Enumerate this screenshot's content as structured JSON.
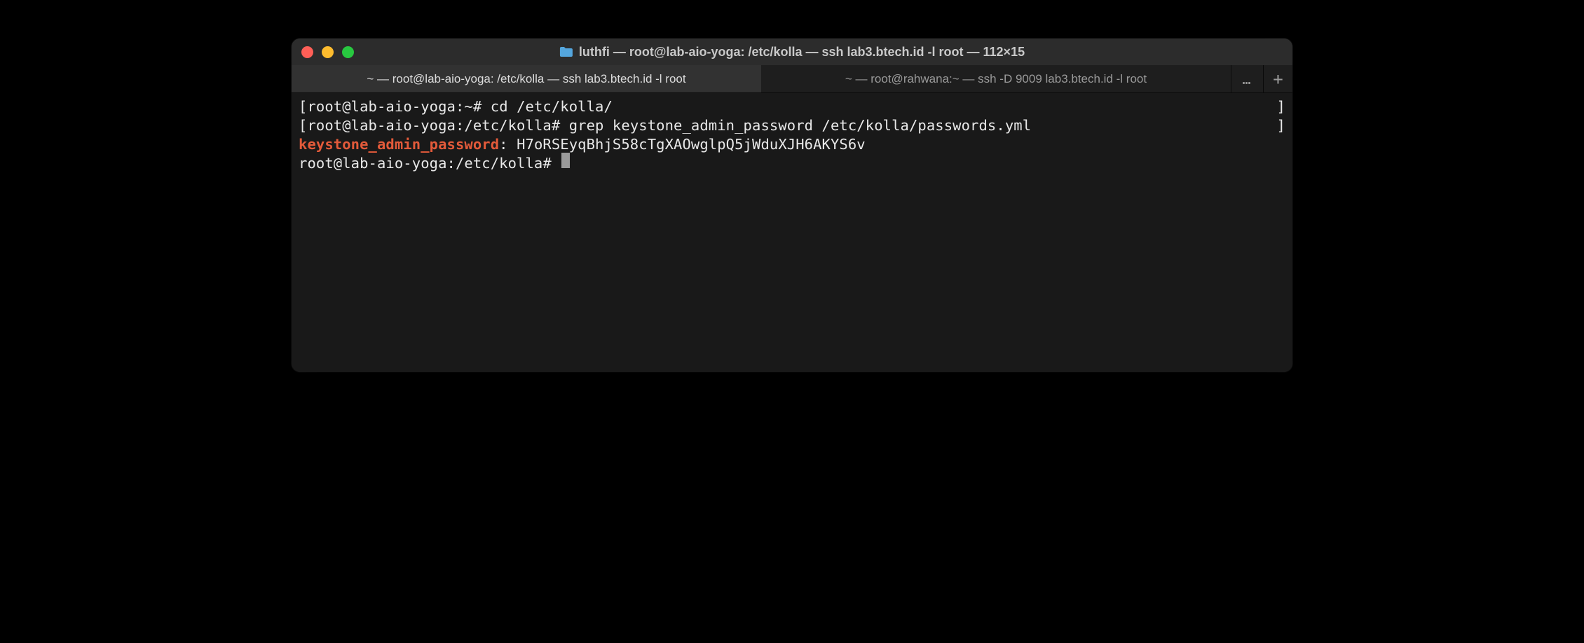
{
  "window": {
    "title": "luthfi — root@lab-aio-yoga: /etc/kolla — ssh lab3.btech.id -l root — 112×15"
  },
  "tabs": [
    {
      "label": "~ — root@lab-aio-yoga: /etc/kolla — ssh lab3.btech.id -l root",
      "active": true
    },
    {
      "label": "~ — root@rahwana:~ — ssh -D 9009 lab3.btech.id -l root",
      "active": false
    }
  ],
  "terminal": {
    "lines": [
      {
        "bracket_left": "[",
        "prompt": "root@lab-aio-yoga:~# ",
        "command": "cd /etc/kolla/",
        "bracket_right": "]"
      },
      {
        "bracket_left": "[",
        "prompt": "root@lab-aio-yoga:/etc/kolla# ",
        "command": "grep keystone_admin_password /etc/kolla/passwords.yml",
        "bracket_right": "]"
      },
      {
        "key": "keystone_admin_password",
        "sep": ": ",
        "value": "H7oRSEyqBhjS58cTgXAOwglpQ5jWduXJH6AKYS6v"
      },
      {
        "prompt": "root@lab-aio-yoga:/etc/kolla# ",
        "cursor": true
      }
    ]
  },
  "icons": {
    "more": "…",
    "add": "+"
  }
}
